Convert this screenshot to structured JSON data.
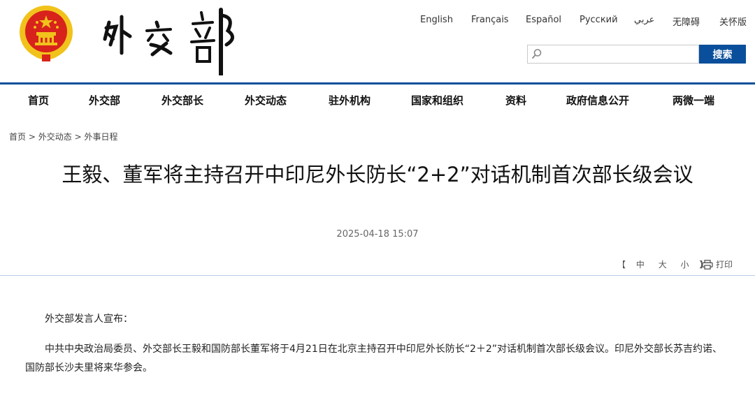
{
  "header": {
    "logo_alt": "外交部",
    "languages": [
      "English",
      "Français",
      "Español",
      "Русский",
      "عربي",
      "无障碍",
      "关怀版"
    ],
    "search": {
      "placeholder": "",
      "value": "",
      "button_label": "搜索"
    }
  },
  "nav": {
    "items": [
      "首页",
      "外交部",
      "外交部长",
      "外交动态",
      "驻外机构",
      "国家和组织",
      "资料",
      "政府信息公开",
      "两微一端"
    ]
  },
  "breadcrumb": {
    "items": [
      "首页",
      "外交动态",
      "外事日程"
    ],
    "separator": ">"
  },
  "article": {
    "title": "王毅、董军将主持召开中印尼外长防长“2+2”对话机制首次部长级会议",
    "date": "2025-04-18 15:07",
    "font_controls": {
      "open": "【",
      "large": "中",
      "medium": "大",
      "small": "小",
      "close": "】"
    },
    "print_label": "打印",
    "paragraphs": [
      "外交部发言人宣布：",
      "中共中央政治局委员、外交部长王毅和国防部长董军将于4月21日在北京主持召开中印尼外长防长“2＋2”对话机制首次部长级会议。印尼外交部长苏吉约诺、国防部长沙夫里将来华参会。"
    ]
  },
  "colors": {
    "brand_blue": "#0a4f9b",
    "emblem_red": "#d8221c",
    "emblem_gold": "#f1c21b"
  }
}
